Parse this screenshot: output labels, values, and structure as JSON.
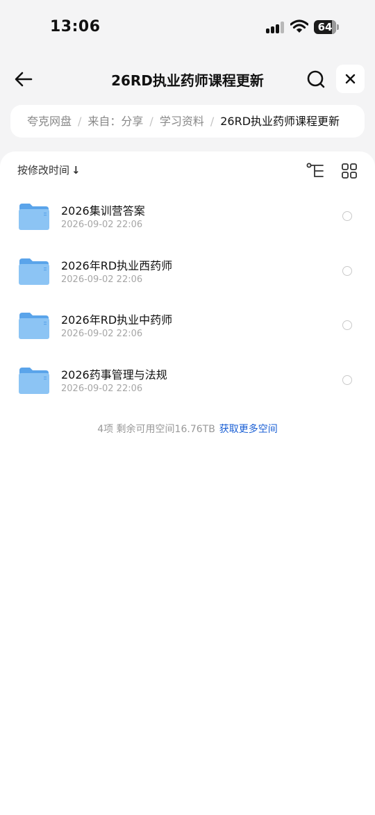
{
  "status_bar": {
    "time": "13:06",
    "battery_level": "64",
    "icons": [
      "signal-icon",
      "wifi-icon",
      "battery-icon"
    ]
  },
  "nav": {
    "title": "26RD执业药师课程更新",
    "icons": [
      "back-arrow-icon",
      "search-icon",
      "close-icon"
    ]
  },
  "breadcrumb": {
    "items": [
      "夸克网盘",
      "来自：分享",
      "学习资料",
      "26RD执业药师课程更新"
    ],
    "separator": "/"
  },
  "toolbar": {
    "sort_label": "按修改时间",
    "sort_arrow": "↓",
    "icons": [
      "tree-view-icon",
      "grid-view-icon"
    ]
  },
  "files": [
    {
      "name": "2026集训营答案",
      "date": "2026-09-02 22:06"
    },
    {
      "name": "2026年RD执业西药师",
      "date": "2026-09-02 22:06"
    },
    {
      "name": "2026年RD执业中药师",
      "date": "2026-09-02 22:06"
    },
    {
      "name": "2026药事管理与法规",
      "date": "2026-09-02 22:06"
    }
  ],
  "footer": {
    "info": "4项 剩余可用空间16.76TB",
    "link": "获取更多空间"
  },
  "colors": {
    "background": "#f4f4f5",
    "card": "#ffffff",
    "accent_link": "#1a5fd4",
    "folder": "#7cb8f0"
  }
}
